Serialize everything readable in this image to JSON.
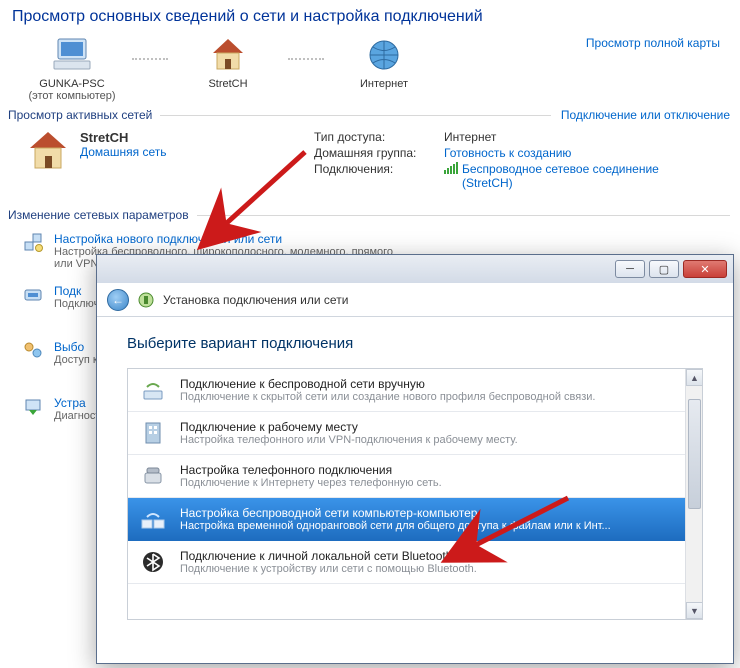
{
  "page_title": "Просмотр основных сведений о сети и настройка подключений",
  "map": {
    "full_map_link": "Просмотр полной карты",
    "nodes": [
      {
        "label1": "GUNKA-PSC",
        "label2": "(этот компьютер)"
      },
      {
        "label1": "StretCH",
        "label2": ""
      },
      {
        "label1": "Интернет",
        "label2": ""
      }
    ]
  },
  "active_section": {
    "heading": "Просмотр активных сетей",
    "rightlink": "Подключение или отключение",
    "network_name": "StretCH",
    "profile_link": "Домашняя сеть",
    "rows": {
      "access_key": "Тип доступа:",
      "access_val": "Интернет",
      "homegroup_key": "Домашняя группа:",
      "homegroup_val": "Готовность к созданию",
      "conn_key": "Подключения:",
      "conn_val": "Беспроводное сетевое соединение (StretCH)"
    }
  },
  "change_section": {
    "heading": "Изменение сетевых параметров",
    "tasks": [
      {
        "title": "Настройка нового подключения или сети",
        "desc": "Настройка беспроводного, широкополосного, модемного, прямого или VPN-подключения или же..."
      },
      {
        "title": "Подк",
        "desc": "Подключение или повторное подключение к беспроводному, проводному, модемному сетевому..."
      },
      {
        "title": "Выбо",
        "desc": "Доступ к файлам и принтерам, расположенным на других сетевых компьютерах, или измен..."
      },
      {
        "title": "Устра",
        "desc": "Диагностика и исправление сетевых проблем или получение сведений об исправлении."
      }
    ]
  },
  "wizard": {
    "header": "Установка подключения или сети",
    "title": "Выберите вариант подключения",
    "options": [
      {
        "title": "Подключение к беспроводной сети вручную",
        "desc": "Подключение к скрытой сети или создание нового профиля беспроводной связи."
      },
      {
        "title": "Подключение к рабочему месту",
        "desc": "Настройка телефонного или VPN-подключения к рабочему месту."
      },
      {
        "title": "Настройка телефонного подключения",
        "desc": "Подключение к Интернету через телефонную сеть."
      },
      {
        "title": "Настройка беспроводной сети компьютер-компьютер",
        "desc": "Настройка временной одноранговой сети для общего доступа к файлам или к Инт..."
      },
      {
        "title": "Подключение к личной локальной сети Bluetooth (PAN)",
        "desc": "Подключение к устройству или сети с помощью Bluetooth."
      }
    ],
    "selected_index": 3
  }
}
